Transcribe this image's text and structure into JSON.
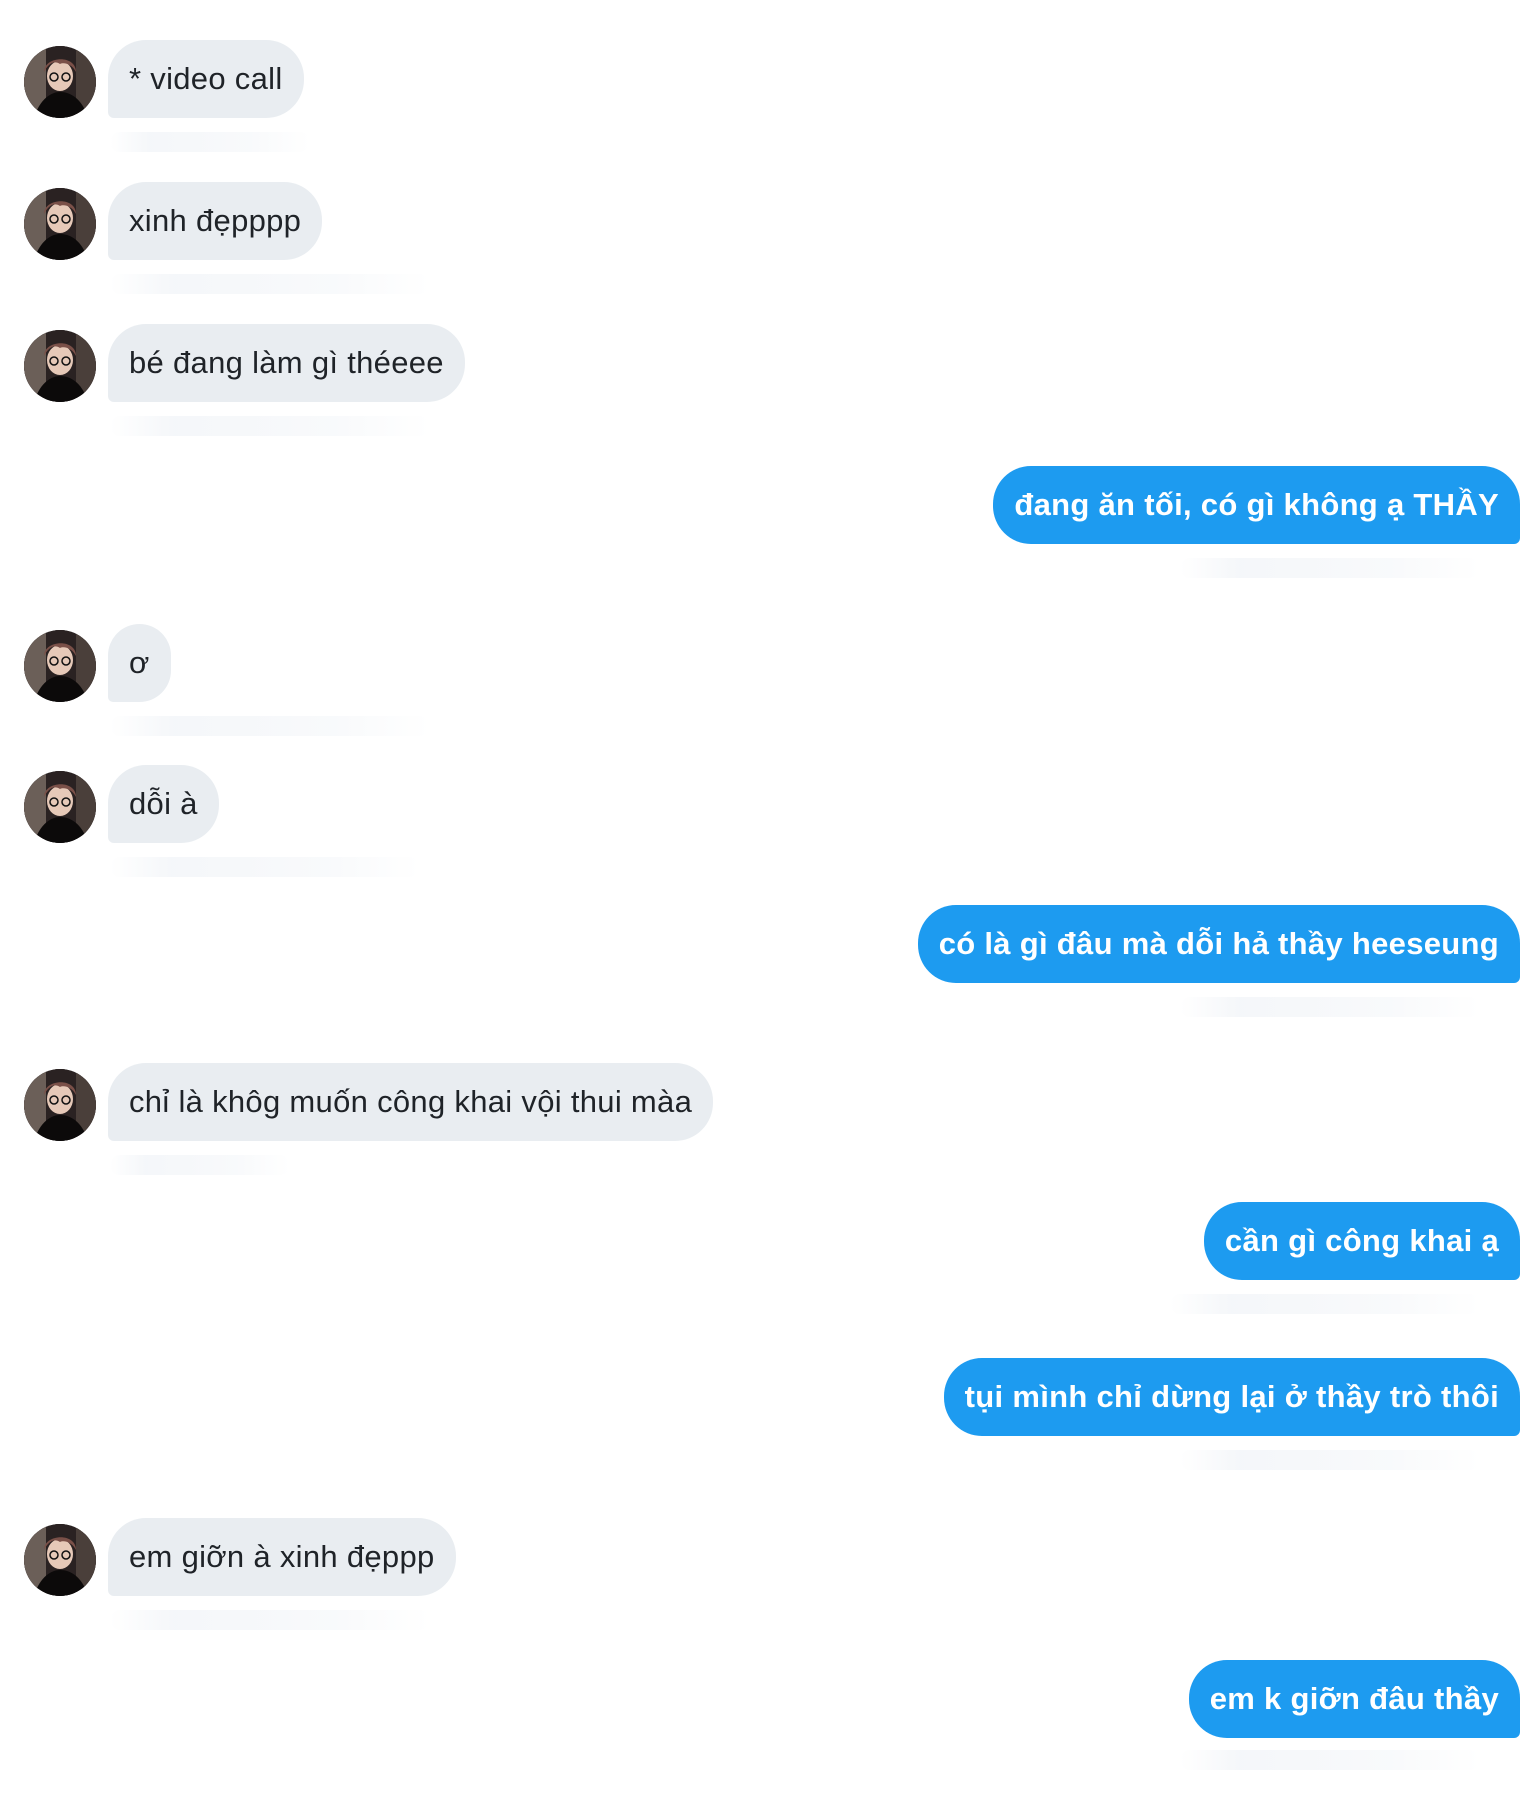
{
  "colors": {
    "incoming_bubble": "#e9edf1",
    "outgoing_bubble": "#1d9bf0",
    "incoming_text": "#1f2328",
    "outgoing_text": "#ffffff",
    "background": "#ffffff"
  },
  "messages": [
    {
      "direction": "incoming",
      "text": "* video call"
    },
    {
      "direction": "incoming",
      "text": "xinh đẹpppp"
    },
    {
      "direction": "incoming",
      "text": "bé đang làm gì théeee"
    },
    {
      "direction": "outgoing",
      "text": "đang ăn tối, có gì không ạ THẦY"
    },
    {
      "direction": "incoming",
      "text": "ơ"
    },
    {
      "direction": "incoming",
      "text": "dỗi à"
    },
    {
      "direction": "outgoing",
      "text": "có là gì đâu mà dỗi hả thầy heeseung"
    },
    {
      "direction": "incoming",
      "text": "chỉ là khôg muốn công khai vội thui màa"
    },
    {
      "direction": "outgoing",
      "text": "cần gì công khai ạ"
    },
    {
      "direction": "outgoing",
      "text": "tụi mình chỉ dừng lại ở thầy trò thôi"
    },
    {
      "direction": "incoming",
      "text": "em giỡn à xinh đẹppp"
    },
    {
      "direction": "outgoing",
      "text": "em k giỡn đâu thầy"
    }
  ]
}
